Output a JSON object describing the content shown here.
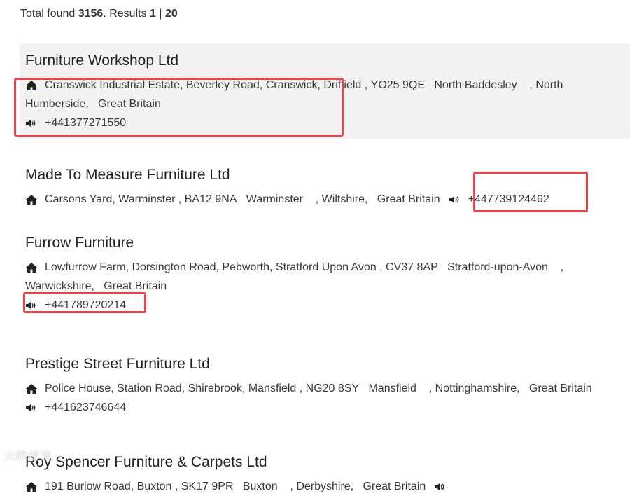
{
  "summary": {
    "prefix": "Total found ",
    "total": "3156",
    "results_label": ". Results ",
    "page_from": "1",
    "separator": " | ",
    "page_to": "20"
  },
  "results": [
    {
      "name": "Furniture Workshop Ltd",
      "address": "Cranswick Industrial Estate, Beverley Road, Cranswick, Driffield , YO25 9QE   North Baddesley    , North Humberside,   Great Britain",
      "phone": "+441377271550"
    },
    {
      "name": "Made To Measure Furniture Ltd",
      "address": "Carsons Yard, Warminster , BA12 9NA   Warminster    , Wiltshire,   Great Britain",
      "phone": "+447739124462"
    },
    {
      "name": "Furrow Furniture",
      "address": "Lowfurrow Farm, Dorsington Road, Pebworth, Stratford Upon Avon , CV37 8AP   Stratford-upon-Avon    , Warwickshire,   Great Britain",
      "phone": "+441789720214"
    },
    {
      "name": "Prestige Street Furniture Ltd",
      "address": "Police House, Station Road, Shirebrook, Mansfield , NG20 8SY   Mansfield    , Nottinghamshire,   Great Britain",
      "phone": "+441623746644"
    },
    {
      "name": "Roy Spencer Furniture & Carpets Ltd",
      "address": "191 Burlow Road, Buxton , SK17 9PR   Buxton    , Derbyshire,   Great Britain"
    }
  ],
  "icons": {
    "address": "home-icon",
    "phone": "speaker-icon"
  },
  "colors": {
    "highlight": "#e8444b",
    "alt_row": "#f3f3f3"
  },
  "watermark": "大眼搜搜"
}
